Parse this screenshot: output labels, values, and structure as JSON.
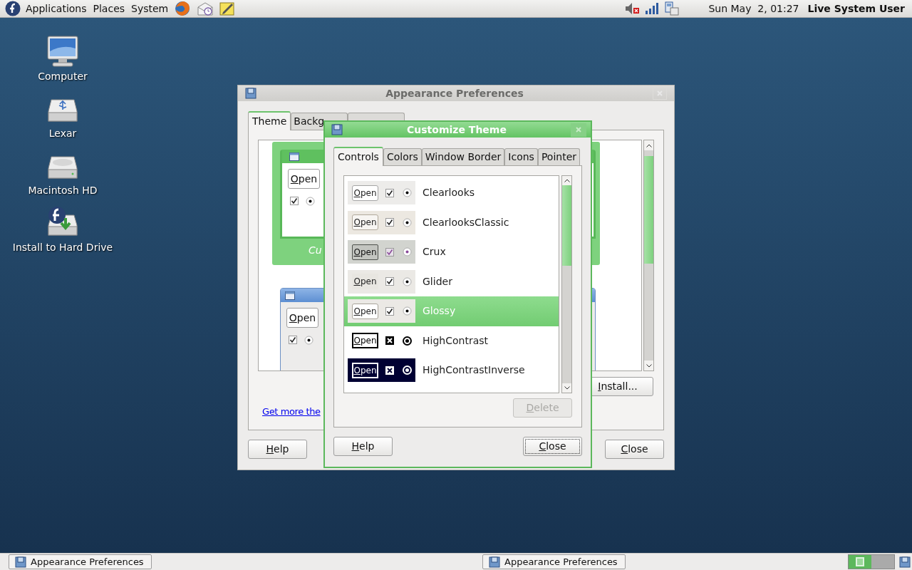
{
  "top_panel": {
    "menus": [
      "Applications",
      "Places",
      "System"
    ],
    "clock": "Sun May  2, 01:27",
    "user": "Live System User"
  },
  "desktop_icons": [
    {
      "label": "Computer",
      "kind": "computer"
    },
    {
      "label": "Lexar",
      "kind": "usb"
    },
    {
      "label": "Macintosh HD",
      "kind": "disk"
    },
    {
      "label": "Install to Hard Drive",
      "kind": "install"
    }
  ],
  "appearance_window": {
    "title": "Appearance Preferences",
    "tabs": [
      {
        "label": "Theme",
        "selected": true
      },
      {
        "label": "Backg",
        "selected": false
      },
      {
        "selected": false
      }
    ],
    "themes": [
      {
        "kind": "green",
        "selected": true,
        "button": "Open",
        "label": "Cu"
      },
      {
        "kind": "blue",
        "selected": false,
        "button": "Open"
      }
    ],
    "install_button": "Install...",
    "link": "Get more the",
    "help_button": "Help",
    "close_button": "Close"
  },
  "customize_window": {
    "title": "Customize Theme",
    "tabs": [
      {
        "label": "Controls",
        "selected": true
      },
      {
        "label": "Colors",
        "selected": false
      },
      {
        "label": "Window Border",
        "selected": false
      },
      {
        "label": "Icons",
        "selected": false
      },
      {
        "label": "Pointer",
        "selected": false
      }
    ],
    "themes": [
      {
        "name": "Clearlooks",
        "kind": "clearlooks",
        "button": "Open",
        "selected": false
      },
      {
        "name": "ClearlooksClassic",
        "kind": "classic",
        "button": "Open",
        "selected": false
      },
      {
        "name": "Crux",
        "kind": "crux",
        "button": "Open",
        "selected": false
      },
      {
        "name": "Glider",
        "kind": "glider",
        "button": "Open",
        "selected": false
      },
      {
        "name": "Glossy",
        "kind": "glossy",
        "button": "Open",
        "selected": true
      },
      {
        "name": "HighContrast",
        "kind": "contrast",
        "button": "Open",
        "selected": false
      },
      {
        "name": "HighContrastInverse",
        "kind": "inverse",
        "button": "Open",
        "selected": false
      }
    ],
    "delete_button": {
      "label": "Delete",
      "disabled": true
    },
    "help_button": "Help",
    "close_button": {
      "label": "Close",
      "focused": true
    }
  },
  "bottom_panel": {
    "tasks": [
      {
        "label": "Appearance Preferences"
      },
      {
        "label": "Appearance Preferences"
      }
    ],
    "workspaces": [
      {
        "selected": true
      },
      {
        "selected": false
      }
    ]
  }
}
